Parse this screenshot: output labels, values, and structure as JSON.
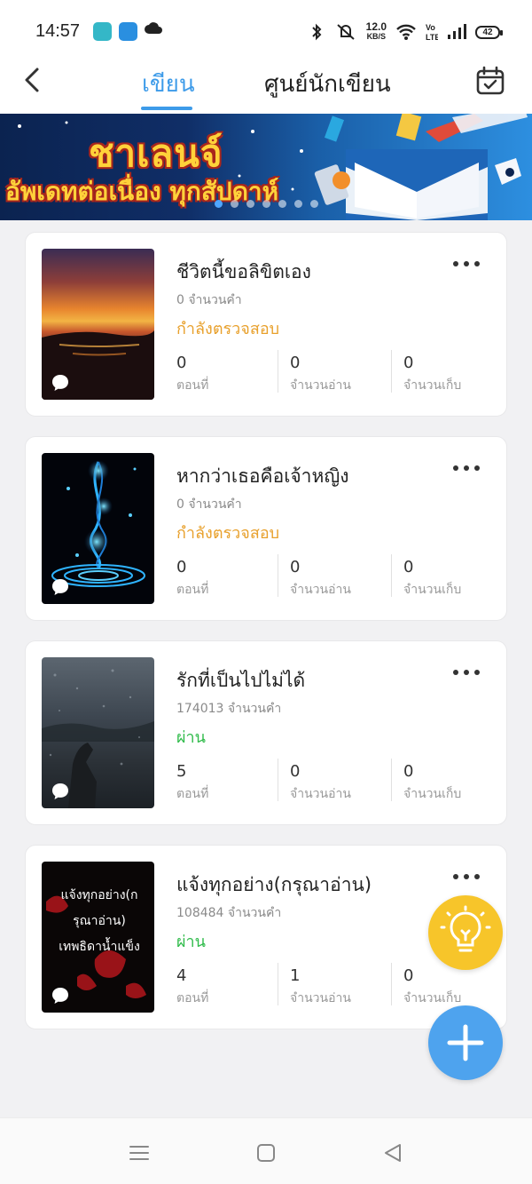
{
  "status_bar": {
    "time": "14:57",
    "speed_value": "12.0",
    "speed_unit": "KB/S",
    "battery": "42"
  },
  "header": {
    "tabs": [
      {
        "label": "เขียน",
        "active": true
      },
      {
        "label": "ศูนย์นักเขียน",
        "active": false
      }
    ]
  },
  "banner": {
    "title": "ชาเลนจ์",
    "subtitle": "อัพเดทต่อเนื่อง ทุกสัปดาห์",
    "slides": 7,
    "active_slide": 0
  },
  "works": [
    {
      "title": "ชีวิตนี้ขอลิขิตเอง",
      "words": "0 จำนวนคำ",
      "status": "กำลังตรวจสอบ",
      "status_type": "review",
      "stats": [
        {
          "value": "0",
          "label": "ตอนที่"
        },
        {
          "value": "0",
          "label": "จำนวนอ่าน"
        },
        {
          "value": "0",
          "label": "จำนวนเก็บ"
        }
      ]
    },
    {
      "title": "หากว่าเธอคือเจ้าหญิง",
      "words": "0 จำนวนคำ",
      "status": "กำลังตรวจสอบ",
      "status_type": "review",
      "stats": [
        {
          "value": "0",
          "label": "ตอนที่"
        },
        {
          "value": "0",
          "label": "จำนวนอ่าน"
        },
        {
          "value": "0",
          "label": "จำนวนเก็บ"
        }
      ]
    },
    {
      "title": "รักที่เป็นไปไม่ได้",
      "words": "174013 จำนวนคำ",
      "status": "ผ่าน",
      "status_type": "pass",
      "stats": [
        {
          "value": "5",
          "label": "ตอนที่"
        },
        {
          "value": "0",
          "label": "จำนวนอ่าน"
        },
        {
          "value": "0",
          "label": "จำนวนเก็บ"
        }
      ]
    },
    {
      "title": "แจ้งทุกอย่าง(กรุณาอ่าน)",
      "words": "108484 จำนวนคำ",
      "status": "ผ่าน",
      "status_type": "pass",
      "cover_text": [
        "แจ้งทุกอย่าง(ก",
        "รุณาอ่าน)",
        "เทพธิดาน้ำแข็ง"
      ],
      "stats": [
        {
          "value": "4",
          "label": "ตอนที่"
        },
        {
          "value": "1",
          "label": "จำนวนอ่าน"
        },
        {
          "value": "0",
          "label": "จำนวนเก็บ"
        }
      ]
    }
  ],
  "colors": {
    "accent": "#3d9be9",
    "review": "#e8a02b",
    "pass": "#2fbb4a",
    "fab_bulb": "#f7c52a",
    "fab_add": "#4ea3ee"
  },
  "icons": [
    "back-arrow-icon",
    "calendar-check-icon",
    "more-icon",
    "comment-icon",
    "lightbulb-icon",
    "plus-icon",
    "menu-icon",
    "home-square-icon",
    "back-triangle-icon"
  ]
}
